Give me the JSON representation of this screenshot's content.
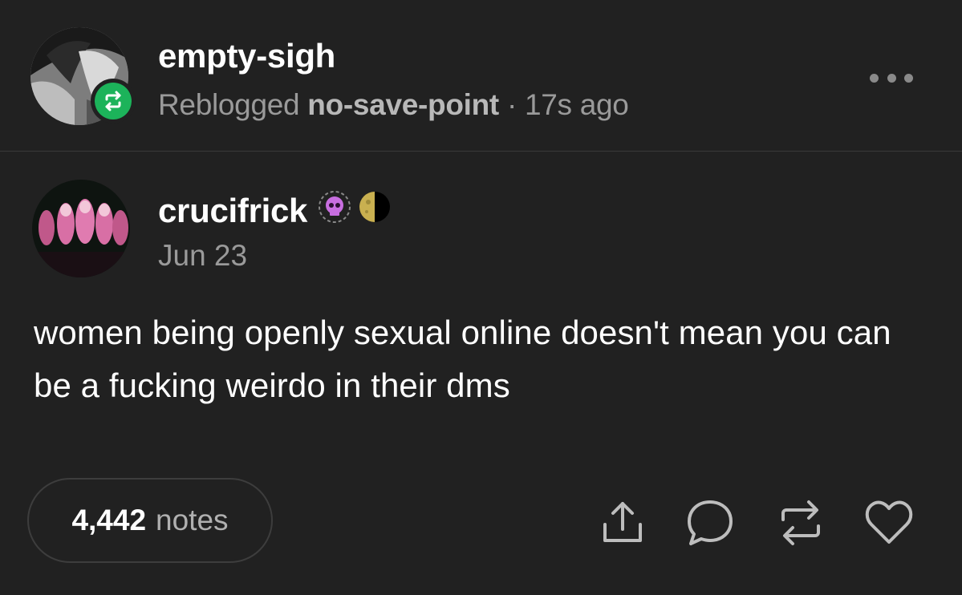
{
  "reblog_header": {
    "username": "empty-sigh",
    "reblogged_prefix": "Reblogged",
    "source_blog": "no-save-point",
    "separator": "·",
    "time_ago": "17s ago",
    "more_icon": "more-horizontal-icon",
    "badge_icon": "reblog-icon",
    "badge_color": "#1cb35a"
  },
  "post": {
    "author": "crucifrick",
    "author_badges": [
      "skull-badge-icon",
      "moon-badge-icon"
    ],
    "date": "Jun 23",
    "body": "women being openly sexual online doesn't mean you can be a fucking weirdo in their dms"
  },
  "footer": {
    "notes_count": "4,442",
    "notes_label": "notes",
    "actions": [
      "share-icon",
      "comment-icon",
      "reblog-icon",
      "heart-icon"
    ]
  },
  "colors": {
    "background": "#212121",
    "text_primary": "#ffffff",
    "text_secondary": "#9a9a9a",
    "divider": "#3a3a3a"
  }
}
